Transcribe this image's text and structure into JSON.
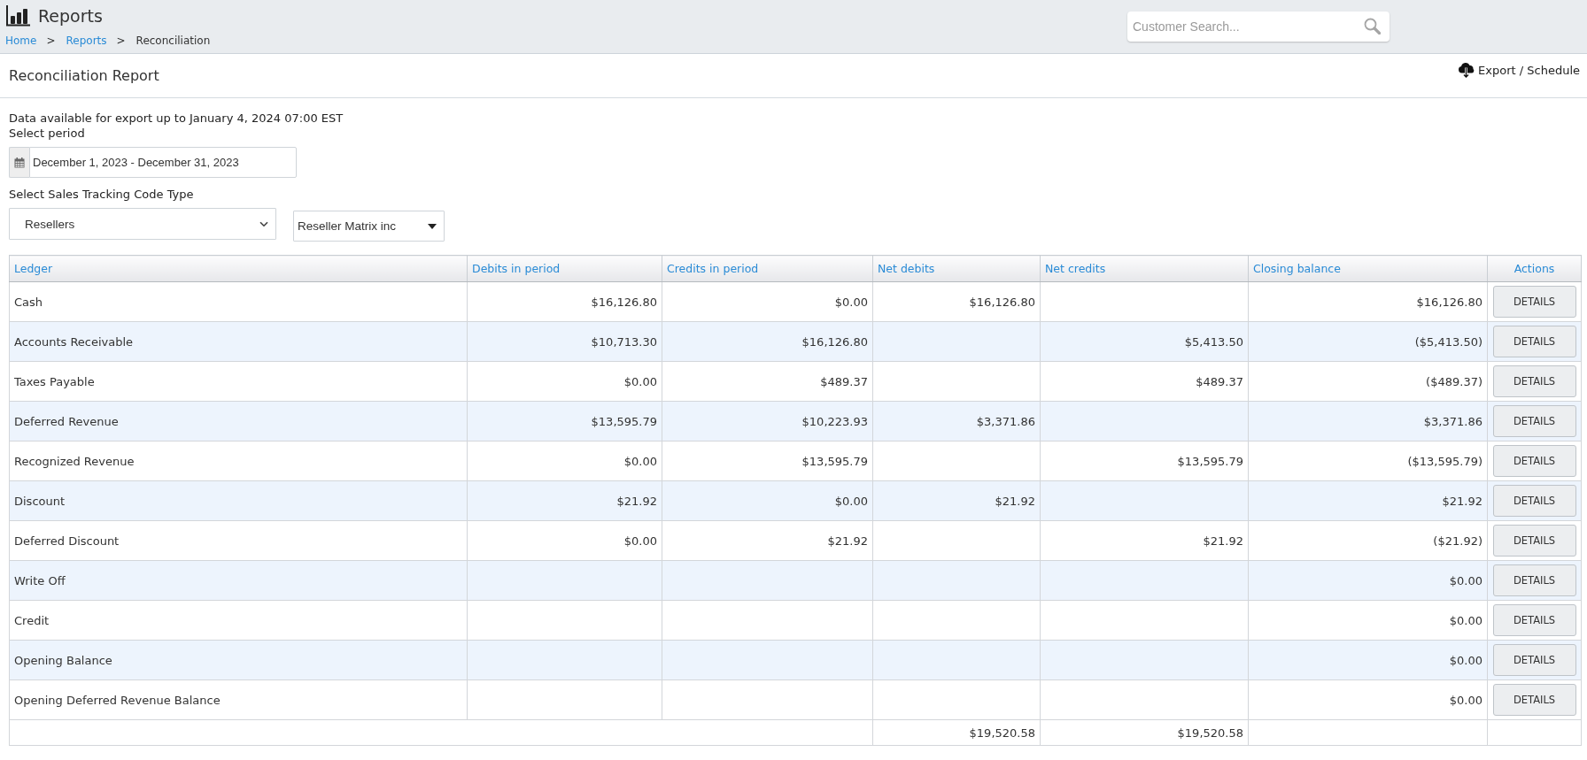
{
  "header": {
    "title": "Reports",
    "breadcrumb": [
      {
        "kind": "link",
        "label": "Home"
      },
      {
        "kind": "separator",
        "label": ">"
      },
      {
        "kind": "link",
        "label": "Reports"
      },
      {
        "kind": "separator",
        "label": ">"
      },
      {
        "kind": "current",
        "label": "Reconciliation"
      }
    ],
    "search": {
      "placeholder": "Customer Search..."
    }
  },
  "page": {
    "title": "Reconciliation Report",
    "export_link": "Export / Schedule"
  },
  "filters": {
    "availability_note": "Data available for export up to January 4, 2024 07:00 EST",
    "period_label": "Select period",
    "period_value": "December 1, 2023 - December 31, 2023",
    "tracking_label": "Select Sales Tracking Code Type",
    "tracking_type": "Resellers",
    "reseller": "Reseller Matrix inc"
  },
  "table": {
    "columns": [
      "Ledger",
      "Debits in period",
      "Credits in period",
      "Net debits",
      "Net credits",
      "Closing balance",
      "Actions"
    ],
    "rows": [
      {
        "ledger": "Cash",
        "debits": "$16,126.80",
        "credits": "$0.00",
        "net_debits": "$16,126.80",
        "closing_balance": "$16,126.80",
        "action": "DETAILS"
      },
      {
        "ledger": "Accounts Receivable",
        "debits": "$10,713.30",
        "credits": "$16,126.80",
        "net_credits": "$5,413.50",
        "closing_balance": "($5,413.50)",
        "action": "DETAILS"
      },
      {
        "ledger": "Taxes Payable",
        "debits": "$0.00",
        "credits": "$489.37",
        "net_credits": "$489.37",
        "closing_balance": "($489.37)",
        "action": "DETAILS"
      },
      {
        "ledger": "Deferred Revenue",
        "debits": "$13,595.79",
        "credits": "$10,223.93",
        "net_debits": "$3,371.86",
        "closing_balance": "$3,371.86",
        "action": "DETAILS"
      },
      {
        "ledger": "Recognized Revenue",
        "debits": "$0.00",
        "credits": "$13,595.79",
        "net_credits": "$13,595.79",
        "closing_balance": "($13,595.79)",
        "action": "DETAILS"
      },
      {
        "ledger": "Discount",
        "debits": "$21.92",
        "credits": "$0.00",
        "net_debits": "$21.92",
        "closing_balance": "$21.92",
        "action": "DETAILS"
      },
      {
        "ledger": "Deferred Discount",
        "debits": "$0.00",
        "credits": "$21.92",
        "net_credits": "$21.92",
        "closing_balance": "($21.92)",
        "action": "DETAILS"
      },
      {
        "ledger": "Write Off",
        "closing_balance": "$0.00",
        "action": "DETAILS"
      },
      {
        "ledger": "Credit",
        "closing_balance": "$0.00",
        "action": "DETAILS"
      },
      {
        "ledger": "Opening Balance",
        "closing_balance": "$0.00",
        "action": "DETAILS"
      },
      {
        "ledger": "Opening Deferred Revenue Balance",
        "closing_balance": "$0.00",
        "action": "DETAILS"
      }
    ],
    "totals": {
      "net_debits": "$19,520.58",
      "net_credits": "$19,520.58"
    }
  }
}
